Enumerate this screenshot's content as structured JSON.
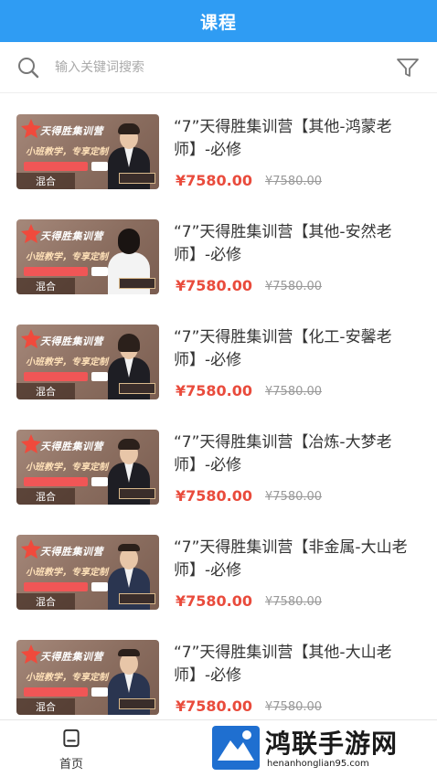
{
  "header": {
    "title": "课程"
  },
  "search": {
    "placeholder": "输入关键词搜索"
  },
  "thumbnail": {
    "brand": "天得胜集训营",
    "slogan": "小班教学，专享定制",
    "tag": "混合"
  },
  "courses": [
    {
      "title": "“7”天得胜集训营【其他-鸿蒙老师】-必修",
      "price": "¥7580.00",
      "original_price": "¥7580.00"
    },
    {
      "title": "“7”天得胜集训营【其他-安然老师】-必修",
      "price": "¥7580.00",
      "original_price": "¥7580.00"
    },
    {
      "title": "“7”天得胜集训营【化工-安馨老师】-必修",
      "price": "¥7580.00",
      "original_price": "¥7580.00"
    },
    {
      "title": "“7”天得胜集训营【冶炼-大梦老师】-必修",
      "price": "¥7580.00",
      "original_price": "¥7580.00"
    },
    {
      "title": "“7”天得胜集训营【非金属-大山老师】-必修",
      "price": "¥7580.00",
      "original_price": "¥7580.00"
    },
    {
      "title": "“7”天得胜集训营【其他-大山老师】-必修",
      "price": "¥7580.00",
      "original_price": "¥7580.00"
    }
  ],
  "tabbar": {
    "home_label": "首页"
  },
  "watermark": {
    "title": "鸿联手游网",
    "url": "henanhonglian95.com"
  },
  "colors": {
    "header_bg": "#2f9cf3",
    "price": "#e94b3c",
    "muted": "#999999"
  }
}
